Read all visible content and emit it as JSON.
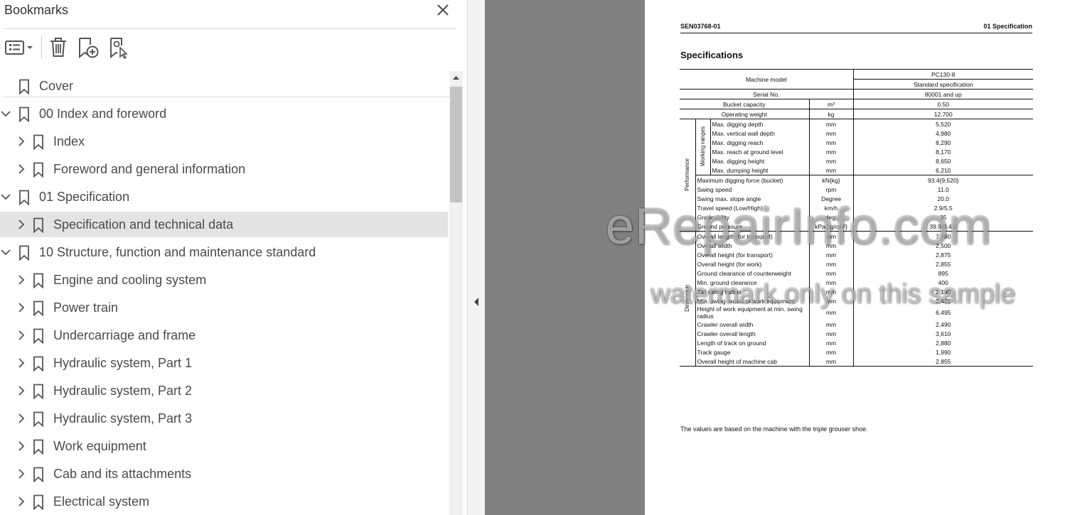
{
  "bookmarks_panel": {
    "title": "Bookmarks",
    "toolbar": {
      "options_icon": "list-options-icon",
      "delete_icon": "trash-icon",
      "add_icon": "add-bookmark-icon",
      "find_icon": "find-bookmark-icon"
    },
    "items": [
      {
        "label": "Cover",
        "level": 0,
        "expander": "none",
        "selected": false
      },
      {
        "label": "00 Index and foreword",
        "level": 0,
        "expander": "expanded",
        "selected": false
      },
      {
        "label": "Index",
        "level": 1,
        "expander": "collapsed",
        "selected": false
      },
      {
        "label": "Foreword and general information",
        "level": 1,
        "expander": "collapsed",
        "selected": false
      },
      {
        "label": "01 Specification",
        "level": 0,
        "expander": "expanded",
        "selected": false
      },
      {
        "label": "Specification and technical data",
        "level": 1,
        "expander": "collapsed",
        "selected": true
      },
      {
        "label": "10 Structure, function and maintenance standard",
        "level": 0,
        "expander": "expanded",
        "selected": false
      },
      {
        "label": "Engine and cooling system",
        "level": 1,
        "expander": "collapsed",
        "selected": false
      },
      {
        "label": "Power train",
        "level": 1,
        "expander": "collapsed",
        "selected": false
      },
      {
        "label": "Undercarriage and frame",
        "level": 1,
        "expander": "collapsed",
        "selected": false
      },
      {
        "label": "Hydraulic system, Part 1",
        "level": 1,
        "expander": "collapsed",
        "selected": false
      },
      {
        "label": "Hydraulic system, Part 2",
        "level": 1,
        "expander": "collapsed",
        "selected": false
      },
      {
        "label": "Hydraulic system, Part 3",
        "level": 1,
        "expander": "collapsed",
        "selected": false
      },
      {
        "label": "Work equipment",
        "level": 1,
        "expander": "collapsed",
        "selected": false
      },
      {
        "label": "Cab and its attachments",
        "level": 1,
        "expander": "collapsed",
        "selected": false
      },
      {
        "label": "Electrical system",
        "level": 1,
        "expander": "collapsed",
        "selected": false
      }
    ]
  },
  "document": {
    "header_left": "SEN03768-01",
    "header_right": "01 Specification",
    "title": "Specifications",
    "table": {
      "machine_model_label": "Machine model",
      "model": "PC130-8",
      "standard_spec": "Standard specification",
      "serial_label": "Serial No.",
      "serial_value": "80001 and up",
      "top_rows": [
        {
          "item": "Bucket capacity",
          "unit": "m³",
          "value": "0.50"
        },
        {
          "item": "Operating weight",
          "unit": "kg",
          "value": "12,700"
        }
      ],
      "performance_label": "Performance",
      "working_ranges_label": "Working ranges",
      "working_ranges": [
        {
          "item": "Max. digging depth",
          "unit": "mm",
          "value": "5,520"
        },
        {
          "item": "Max. vertical wall depth",
          "unit": "mm",
          "value": "4,980"
        },
        {
          "item": "Max. digging reach",
          "unit": "mm",
          "value": "8,290"
        },
        {
          "item": "Max. reach at ground level",
          "unit": "mm",
          "value": "8,170"
        },
        {
          "item": "Max. digging height",
          "unit": "mm",
          "value": "8,650"
        },
        {
          "item": "Max. dumping height",
          "unit": "mm",
          "value": "6,210"
        }
      ],
      "performance_rows": [
        {
          "item": "Maximum digging force (bucket)",
          "unit": "kN{kg}",
          "value": "93.4{9,520}"
        },
        {
          "item": "Swing speed",
          "unit": "rpm",
          "value": "11.0"
        },
        {
          "item": "Swing max. slope angle",
          "unit": "Degree",
          "value": "20.0"
        },
        {
          "item": "Travel speed (Low/High)",
          "unit": "km/h",
          "value": "2.9/5.5"
        },
        {
          "item": "Gradeability",
          "unit": "deg.",
          "value": "35"
        },
        {
          "item": "Ground pressure",
          "unit": "kPa{kg/cm²}",
          "value": "39.9{0.41}"
        }
      ],
      "dimension_label": "Dimension",
      "dimension_rows": [
        {
          "item": "Overall length (for transport)",
          "unit": "mm",
          "value": "7,590"
        },
        {
          "item": "Overall width",
          "unit": "mm",
          "value": "2,500"
        },
        {
          "item": "Overall height (for transport)",
          "unit": "mm",
          "value": "2,875"
        },
        {
          "item": "Overall height (for work)",
          "unit": "mm",
          "value": "2,855"
        },
        {
          "item": "Ground clearance of counterweight",
          "unit": "mm",
          "value": "895"
        },
        {
          "item": "Min. ground clearance",
          "unit": "mm",
          "value": "400"
        },
        {
          "item": "Tail swing radius",
          "unit": "mm",
          "value": "2,190"
        },
        {
          "item": "Min. swing radius of work equipment",
          "unit": "mm",
          "value": "2,450"
        },
        {
          "item": "Height of work equipment at min. swing radius",
          "unit": "mm",
          "value": "6,495"
        },
        {
          "item": "Crawler overall width",
          "unit": "mm",
          "value": "2,490"
        },
        {
          "item": "Crawler overall length",
          "unit": "mm",
          "value": "3,610"
        },
        {
          "item": "Length of track on ground",
          "unit": "mm",
          "value": "2,880"
        },
        {
          "item": "Track gauge",
          "unit": "mm",
          "value": "1,990"
        },
        {
          "item": "Overall height of machine cab",
          "unit": "mm",
          "value": "2,855"
        }
      ]
    },
    "note": "The values are based on the machine with the triple grouser shoe."
  },
  "watermark": {
    "main": "eRepairInfo.com",
    "sub": "watermark only on this sample"
  }
}
